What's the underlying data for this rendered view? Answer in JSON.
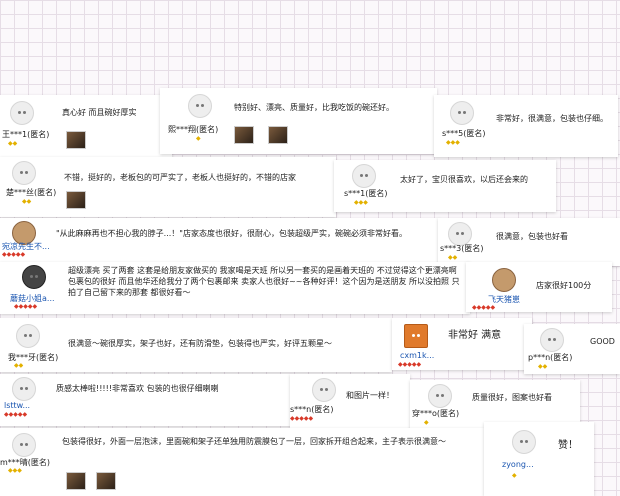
{
  "reviews": [
    {
      "user": "王***1(匿名)",
      "text": "真心好 而且碗好厚实",
      "rating": "◆◆"
    },
    {
      "user": "熙***翔(匿名)",
      "text": "特别好、漂亮、质量好，比我吃饭的碗还好。",
      "rating": "◆"
    },
    {
      "user": "s***5(匿名)",
      "text": "非常好，很满意，包装也仔细。",
      "rating": "◆◆◆"
    },
    {
      "user": "楚***丝(匿名)",
      "text": "不错，挺好的，老板包的可严实了，老板人也挺好的，不错的店家",
      "rating": "◆◆"
    },
    {
      "user": "s***1(匿名)",
      "text": "太好了，宝贝很喜欢，以后还会来的",
      "rating": "◆◆◆"
    },
    {
      "user": "宛凉先生不...",
      "text": "\"从此麻麻再也不担心我的脖子...！\"店家态度也很好，很耐心，包装超级严实，碗碗必须非常好看。",
      "rating": "◆◆◆◆◆"
    },
    {
      "user": "s***3(匿名)",
      "text": "很满意，包装也好看",
      "rating": "◆◆"
    },
    {
      "user": "蘑菇小姐a...",
      "text": "超级漂亮 买了两套 这套是给朋友家做买的 我家喝是天班 所以另一套买的是画着天班的 不过觉得这个更漂亮啊 包裹包的很好 而且他华还给我分了两个包裹邮来 卖家人也很好~~各种好评！这个因为是送朋友 所以没拍照 只拍了自己留下来的那套 都很好看～",
      "rating": "◆◆◆◆◆"
    },
    {
      "user": "飞天猪崽",
      "text": "店家很好100分",
      "rating": "◆◆◆◆◆"
    },
    {
      "user": "我***牙(匿名)",
      "text": "很满意～碗很厚实，架子也好，还有防滑垫，包装得也严实，好评五颗星～",
      "rating": "◆◆"
    },
    {
      "user": "cxm1k...",
      "text": "非常好 满意",
      "rating": "◆◆◆◆◆"
    },
    {
      "user": "p***n(匿名)",
      "text": "GOOD",
      "rating": "◆◆"
    },
    {
      "user": "lsttw...",
      "text": "质感太棒啦!!!!!非常喜欢 包装的也很仔细喇喇",
      "rating": "◆◆◆◆◆"
    },
    {
      "user": "s***n(匿名)",
      "text": "和图片一样！",
      "rating": "◆◆◆◆◆"
    },
    {
      "user": "穿***o(匿名)",
      "text": "质量很好，图案也好看",
      "rating": "◆"
    },
    {
      "user": "m***晴(匿名)",
      "text": "包装得很好，外面一层泡沫，里面碗和架子还单独用防震膜包了一层，回家拆开组合起来，主子表示很满意～",
      "rating": "◆◆◆"
    },
    {
      "user": "zyong...",
      "text": "赞！",
      "rating": "◆"
    }
  ],
  "colors": {
    "rating_gold": "#e3b100",
    "rating_red": "#d83a2a",
    "link_blue": "#1a55b0",
    "grid_line": "#e6dde6"
  }
}
